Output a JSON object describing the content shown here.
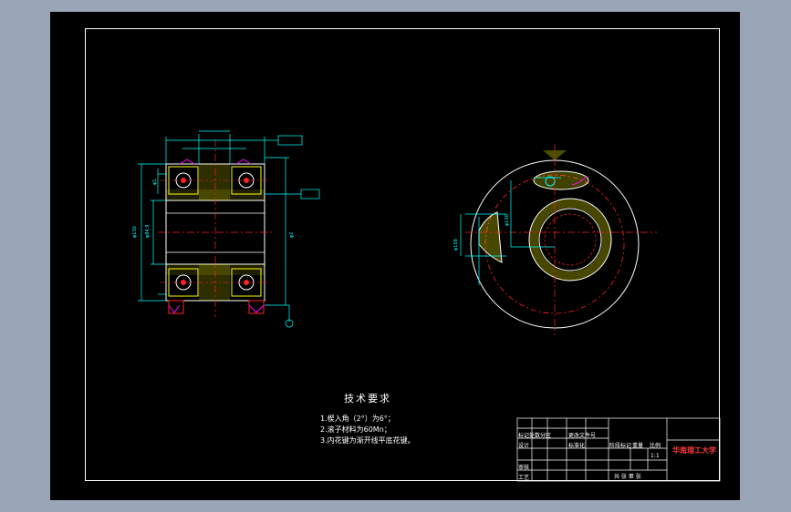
{
  "drawing": {
    "colors": {
      "background": "#000000",
      "frame": "#ffffff",
      "outline": "#ffffff",
      "dimension": "#00ffff",
      "centerline": "#ff2020",
      "hatch": "#ffff00",
      "bearing": "#ffff00",
      "highlight": "#ff00ff"
    },
    "left_view_labels": [
      "φ130",
      "φ84.9",
      "φ2",
      "φ1"
    ],
    "right_view_labels": [
      "φ158",
      "φ130"
    ]
  },
  "technical_requirements": {
    "title": "技术要求",
    "items": [
      "1.楔入角（2°）为6°；",
      "2.滚子材料为60Mn；",
      "3.内花键为渐开线平底花键。"
    ]
  },
  "title_block": {
    "company": "华南理工大学",
    "scale_label": "比例",
    "scale_value": "1:1",
    "weight_label": "重量",
    "stage_label": "阶段标记",
    "sheet_text": "共 张 第 张",
    "rows": [
      "标记处数分区",
      "设计",
      "审核",
      "工艺"
    ],
    "cells": [
      "更改文件号",
      "标准化"
    ]
  }
}
